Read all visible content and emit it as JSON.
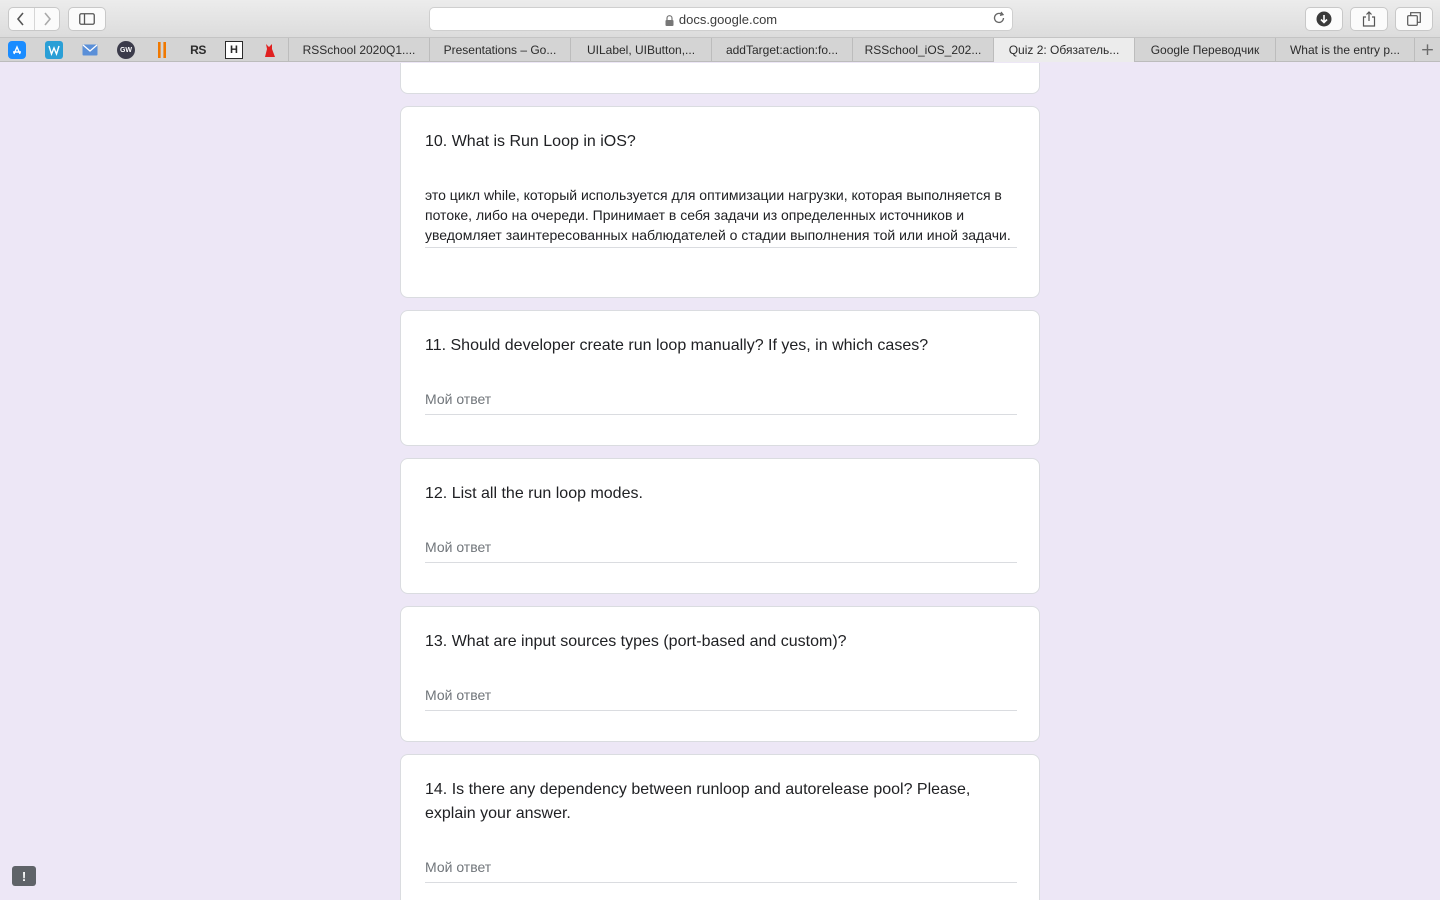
{
  "browser": {
    "url": "docs.google.com",
    "colors": {
      "toolbar": "#dcdcdc",
      "tab_active": "#ececec"
    }
  },
  "favorites": [
    {
      "name": "app-store-icon",
      "color": "#1a8cff"
    },
    {
      "name": "translate-w-icon",
      "color": "#2a9fd6"
    },
    {
      "name": "mail-icon",
      "color": "#5a8fd8"
    },
    {
      "name": "gw-icon",
      "color": "#3b3b4a"
    },
    {
      "name": "bars-icon",
      "color": "#f07800"
    },
    {
      "name": "rs-icon",
      "color": "#2b2b2b"
    },
    {
      "name": "h-icon",
      "color": "#2b2b2b"
    },
    {
      "name": "cat-icon",
      "color": "#e02020"
    }
  ],
  "tabs": [
    "RSSchool 2020Q1....",
    "Presentations – Go...",
    "UILabel, UIButton,...",
    "addTarget:action:fo...",
    "RSSchool_iOS_202...",
    "Quiz 2: Обязатель...",
    "Google Переводчик",
    "What is the entry p..."
  ],
  "form": {
    "accent": "#ede7f6",
    "questions": [
      {
        "title": "10. What is Run Loop in iOS?",
        "answer": "это цикл while, который используется для оптимизации нагрузки, которая выполняется в потоке, либо на очереди. Принимает в себя задачи из определенных источников и уведомляет заинтересованных наблюдателей о стадии выполнения той или иной задачи."
      },
      {
        "title": "11. Should developer create run loop manually? If yes, in which cases?",
        "placeholder": "Мой ответ"
      },
      {
        "title": "12. List all the run loop modes.",
        "placeholder": "Мой ответ"
      },
      {
        "title": "13. What are input sources types (port-based and custom)?",
        "placeholder": "Мой ответ"
      },
      {
        "title": "14. Is there any dependency between runloop and autorelease pool? Please, explain your answer.",
        "placeholder": "Мой ответ"
      }
    ],
    "report_icon": "exclamation-icon"
  }
}
